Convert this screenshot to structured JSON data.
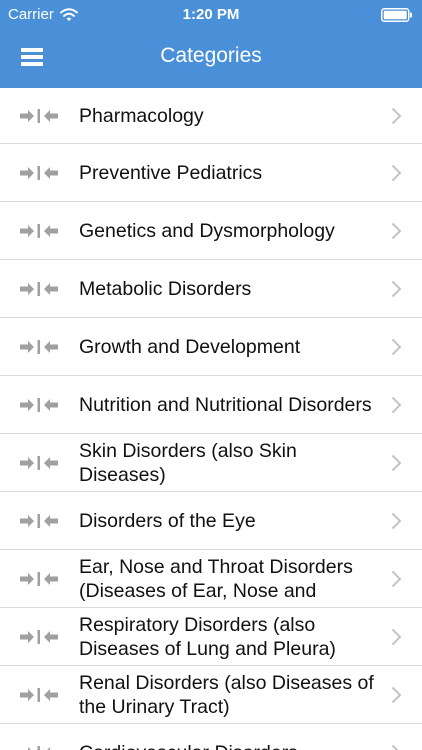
{
  "status_bar": {
    "carrier": "Carrier",
    "time": "1:20 PM",
    "wifi_icon": "wifi-icon",
    "battery_icon": "battery-icon"
  },
  "nav": {
    "title": "Categories",
    "menu_icon": "hamburger-menu-icon"
  },
  "colors": {
    "header_bg": "#4a90d9",
    "row_icon": "#a0a0a0",
    "chevron": "#c4c4c8",
    "divider": "#dadade"
  },
  "categories": [
    {
      "label": "Pharmacology"
    },
    {
      "label": "Preventive Pediatrics"
    },
    {
      "label": "Genetics and Dysmorphology"
    },
    {
      "label": "Metabolic Disorders"
    },
    {
      "label": "Growth and Development"
    },
    {
      "label": "Nutrition and Nutritional Disorders"
    },
    {
      "label": "Skin Disorders (also Skin Diseases)"
    },
    {
      "label": "Disorders of the Eye"
    },
    {
      "label": "Ear, Nose and Throat Disorders (Diseases of Ear, Nose and"
    },
    {
      "label": "Respiratory Disorders (also Diseases of Lung and Pleura)"
    },
    {
      "label": "Renal Disorders (also Diseases of the Urinary Tract)"
    },
    {
      "label": "Cardiovascular Disorders"
    }
  ]
}
